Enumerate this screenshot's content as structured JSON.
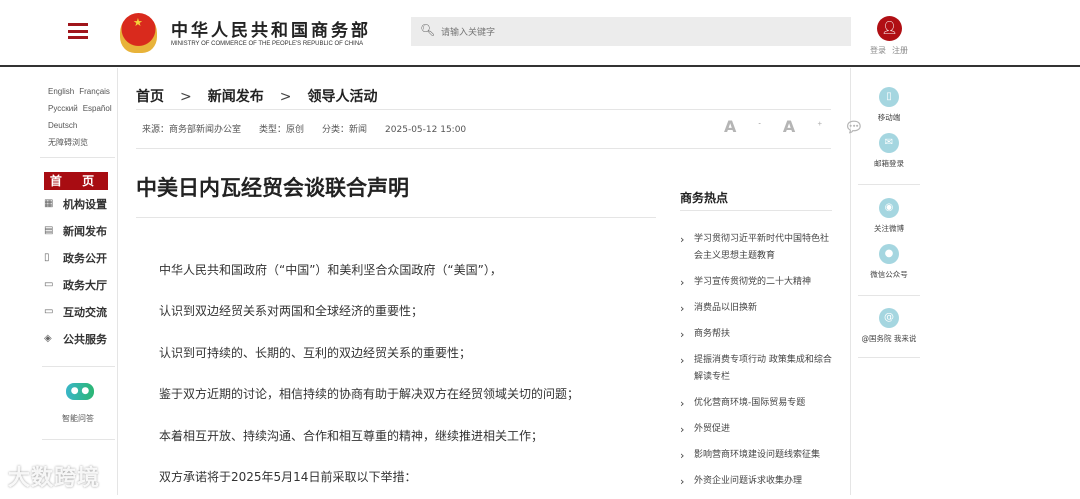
{
  "header": {
    "site_name_cn": "中华人民共和国商务部",
    "site_name_en": "MINISTRY OF COMMERCE OF THE PEOPLE'S REPUBLIC OF CHINA",
    "search_placeholder": "请输入关键字",
    "login": "登录",
    "register": "注册",
    "accent": "#a80c12"
  },
  "languages": [
    "English",
    "Français",
    "Русский",
    "Español",
    "Deutsch",
    "无障碍浏览"
  ],
  "nav": {
    "home": "首 页",
    "items": [
      {
        "label": "机构设置",
        "icon": "grid-icon"
      },
      {
        "label": "新闻发布",
        "icon": "news-icon"
      },
      {
        "label": "政务公开",
        "icon": "document-icon"
      },
      {
        "label": "政务大厅",
        "icon": "monitor-icon"
      },
      {
        "label": "互动交流",
        "icon": "chat-icon"
      },
      {
        "label": "公共服务",
        "icon": "service-icon"
      }
    ],
    "assistant": "智能问答"
  },
  "breadcrumb": [
    "首页",
    "新闻发布",
    "领导人活动"
  ],
  "meta": {
    "source": "来源：商务部新闻办公室",
    "type": "类型：原创",
    "category": "分类：新闻",
    "datetime": "2025-05-12 15:00"
  },
  "tools": {
    "font_smaller": "A",
    "font_larger": "A"
  },
  "article": {
    "title": "中美日内瓦经贸会谈联合声明",
    "paragraphs": [
      "中华人民共和国政府（“中国”）和美利坚合众国政府（“美国”），",
      "认识到双边经贸关系对两国和全球经济的重要性；",
      "认识到可持续的、长期的、互利的双边经贸关系的重要性；",
      "鉴于双方近期的讨论，相信持续的协商有助于解决双方在经贸领域关切的问题；",
      "本着相互开放、持续沟通、合作和相互尊重的精神，继续推进相关工作；",
      "双方承诺将于2025年5月14日前采取以下举措："
    ]
  },
  "hot": {
    "title": "商务热点",
    "items": [
      "学习贯彻习近平新时代中国特色社会主义思想主题教育",
      "学习宣传贯彻党的二十大精神",
      "消费品以旧换新",
      "商务帮扶",
      "提振消费专项行动 政策集成和综合解读专栏",
      "优化营商环境-国际贸易专题",
      "外贸促进",
      "影响营商环境建设问题线索征集",
      "外资企业问题诉求收集办理"
    ]
  },
  "rail": [
    "移动端",
    "邮箱登录",
    "关注微博",
    "微信公众号",
    "@国务院 我来说"
  ],
  "watermark": "大数跨境"
}
